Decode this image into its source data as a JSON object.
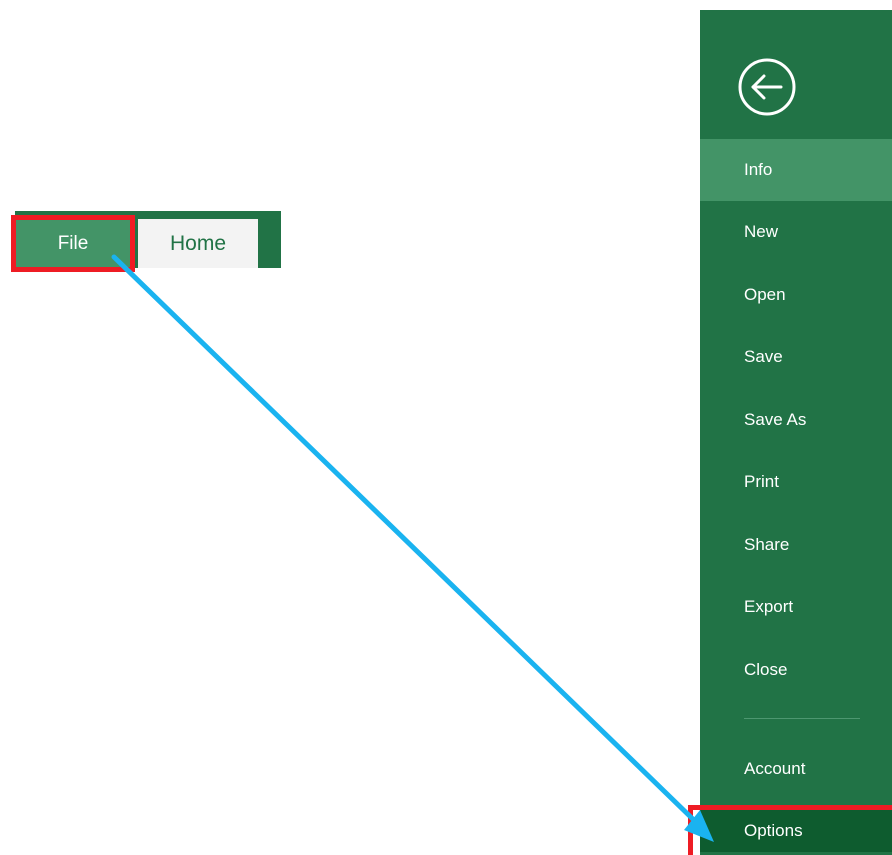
{
  "ribbon": {
    "tabs": [
      {
        "label": "File"
      },
      {
        "label": "Home"
      }
    ]
  },
  "backstage": {
    "back_icon": "back-arrow-circle-icon",
    "items": [
      {
        "label": "Info",
        "active": true
      },
      {
        "label": "New"
      },
      {
        "label": "Open"
      },
      {
        "label": "Save"
      },
      {
        "label": "Save As"
      },
      {
        "label": "Print"
      },
      {
        "label": "Share"
      },
      {
        "label": "Export"
      },
      {
        "label": "Close"
      },
      {
        "label": "Account"
      },
      {
        "label": "Options"
      }
    ]
  },
  "colors": {
    "excel_green": "#217346",
    "active_green": "#439467",
    "options_green": "#0e5c2f",
    "highlight_red": "#ee1c24",
    "arrow_blue": "#1ab3f0"
  }
}
